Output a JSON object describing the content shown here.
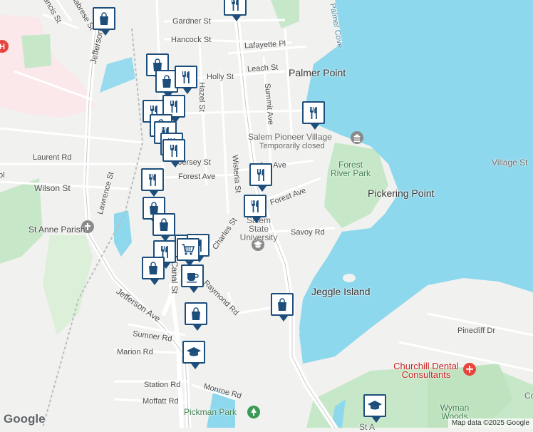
{
  "streets": [
    "Gardner St",
    "Hancock St",
    "Lafayette Pl",
    "Leach St",
    "Holly St",
    "Hazel St",
    "Summit Ave",
    "Laurent Rd",
    "Wilson St",
    "Lawrence St",
    "Jersey St",
    "Forest Ave",
    "Wisteria St",
    "Forest Ave",
    "Savoy Rd",
    "Charles St",
    "Raymond Rd",
    "Canal St",
    "Jefferson Ave",
    "Sumner Rd",
    "Marion Rd",
    "Station Rd",
    "Monroe Rd",
    "Moffatt Rd",
    "Pinecliff Dr",
    "Jefferson Ave",
    "Calabrese St",
    "Francis St",
    "ol",
    "lon Ave"
  ],
  "areas": [
    "Palmer Point",
    "Pickering Point",
    "Jeggle Island",
    "Village St"
  ],
  "parks": [
    "Forest River Park",
    "Pickman Park",
    "Wyman Woods"
  ],
  "water": [
    "Palmer Cove"
  ],
  "pois": {
    "pioneer_village": "Salem Pioneer Village",
    "pioneer_status": "Temporarily closed",
    "university": "Salem State University",
    "parish": "St Anne Parish",
    "dental": "Churchill Dental Consultants",
    "partial_bottom": "St A",
    "partial_right": "Co"
  },
  "footer": {
    "attribution": "Map data ©2025 Google",
    "logo": "Google"
  },
  "colors": {
    "water": "#8ed8ee",
    "park": "#bfe6c2",
    "road": "#ffffff",
    "marker": "#1d4e7b",
    "hospital": "#e8453c"
  },
  "markers": [
    {
      "type": "dining",
      "name": "restaurant-marker"
    },
    {
      "type": "shopping",
      "name": "shopping-marker"
    },
    {
      "type": "cafe",
      "name": "cafe-marker"
    },
    {
      "type": "grocery",
      "name": "grocery-marker"
    },
    {
      "type": "school",
      "name": "school-marker"
    }
  ]
}
